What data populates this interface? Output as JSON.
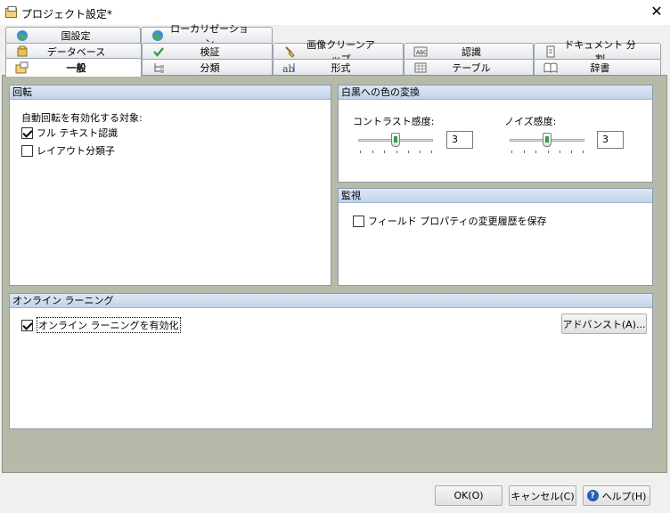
{
  "window": {
    "title": "プロジェクト設定*",
    "close_glyph": "✕"
  },
  "tabs": {
    "row1": [
      {
        "label": "国設定",
        "icon": "globe-icon"
      },
      {
        "label": "ローカリゼーション",
        "icon": "globe-icon"
      }
    ],
    "row2": [
      {
        "label": "データベース",
        "icon": "database-icon"
      },
      {
        "label": "検証",
        "icon": "checkmark-icon"
      },
      {
        "label": "画像クリーンアップ",
        "icon": "brush-icon"
      },
      {
        "label": "認識",
        "icon": "abc-recognition-icon"
      },
      {
        "label": "ドキュメント 分割",
        "icon": "document-split-icon"
      }
    ],
    "row3": [
      {
        "label": "一般",
        "icon": "general-settings-icon",
        "active": true
      },
      {
        "label": "分類",
        "icon": "tree-icon"
      },
      {
        "label": "形式",
        "icon": "format-icon"
      },
      {
        "label": "テーブル",
        "icon": "table-icon"
      },
      {
        "label": "辞書",
        "icon": "book-icon"
      }
    ]
  },
  "rotation": {
    "header": "回転",
    "label": "自動回転を有効化する対象:",
    "options": [
      {
        "label": "フル テキスト認識",
        "checked": true
      },
      {
        "label": "レイアウト分類子",
        "checked": false
      }
    ]
  },
  "bw": {
    "header": "白黒への色の変換",
    "contrast": {
      "label": "コントラスト感度:",
      "value": "3",
      "level": 3,
      "max": 6
    },
    "noise": {
      "label": "ノイズ感度:",
      "value": "3",
      "level": 3,
      "max": 6
    }
  },
  "monitor": {
    "header": "監視",
    "option": {
      "label": "フィールド プロパティの変更履歴を保存",
      "checked": false
    }
  },
  "online": {
    "header": "オンライン ラーニング",
    "option": {
      "label": "オンライン ラーニングを有効化",
      "checked": true
    },
    "advanced_label": "アドバンスト(A)..."
  },
  "buttons": {
    "ok": "OK(O)",
    "cancel": "キャンセル(C)",
    "help": "ヘルプ(H)"
  },
  "colors": {
    "content_bg": "#b5bba8",
    "panel_header": "#c9d8ee",
    "slider_thumb": "#2fa344"
  }
}
